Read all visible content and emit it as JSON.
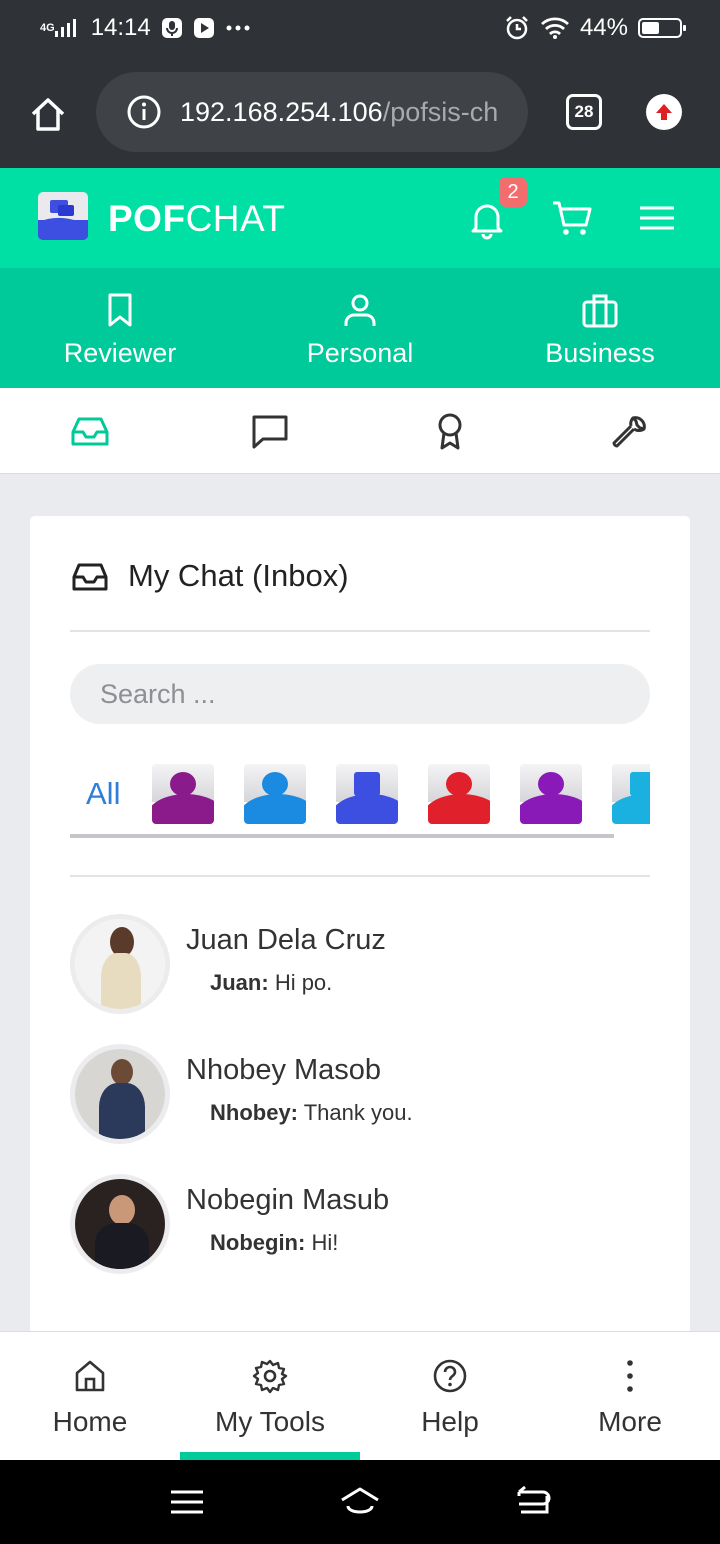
{
  "status_bar": {
    "network": "4G",
    "time": "14:14",
    "battery": "44%",
    "notification_icons": [
      "microphone-icon",
      "youtube-icon",
      "more-dots-icon"
    ],
    "right_icons": [
      "alarm-icon",
      "wifi-icon",
      "battery-icon"
    ]
  },
  "browser": {
    "url_host": "192.168.254.106",
    "url_path": "/pofsis-ch",
    "tab_count": "28"
  },
  "app": {
    "brand_bold": "POF",
    "brand_light": "CHAT",
    "notification_count": "2"
  },
  "categories": [
    {
      "label": "Reviewer",
      "icon": "bookmark-icon"
    },
    {
      "label": "Personal",
      "icon": "user-icon"
    },
    {
      "label": "Business",
      "icon": "briefcase-icon"
    }
  ],
  "subnav_icons": [
    "inbox-icon",
    "chat-bubble-icon",
    "award-icon",
    "wrench-icon"
  ],
  "inbox": {
    "title": "My Chat (Inbox)",
    "search_placeholder": "Search ...",
    "filter_all": "All",
    "filter_icons": [
      {
        "name": "reviewer-app-icon",
        "color": "#8b1a8b"
      },
      {
        "name": "cloud-chat-app-icon",
        "color": "#1a8be0"
      },
      {
        "name": "pofchat-app-icon",
        "color": "#3d4fe0"
      },
      {
        "name": "support-app-icon",
        "color": "#e0202a"
      },
      {
        "name": "mind-app-icon",
        "color": "#8a1ab8"
      },
      {
        "name": "books-app-icon",
        "color": "#1ab0e0"
      }
    ],
    "chats": [
      {
        "name": "Juan Dela Cruz",
        "sender": "Juan:",
        "message": "Hi po."
      },
      {
        "name": "Nhobey Masob",
        "sender": "Nhobey:",
        "message": "Thank you."
      },
      {
        "name": "Nobegin Masub",
        "sender": "Nobegin:",
        "message": "Hi!"
      }
    ]
  },
  "bottom_nav": [
    {
      "label": "Home",
      "icon": "home-icon"
    },
    {
      "label": "My Tools",
      "icon": "gear-icon"
    },
    {
      "label": "Help",
      "icon": "help-icon"
    },
    {
      "label": "More",
      "icon": "more-vertical-icon"
    }
  ],
  "colors": {
    "primary": "#00e0a5",
    "primary_dark": "#00c99a",
    "link": "#2f7fd8",
    "badge": "#f26d6d"
  }
}
